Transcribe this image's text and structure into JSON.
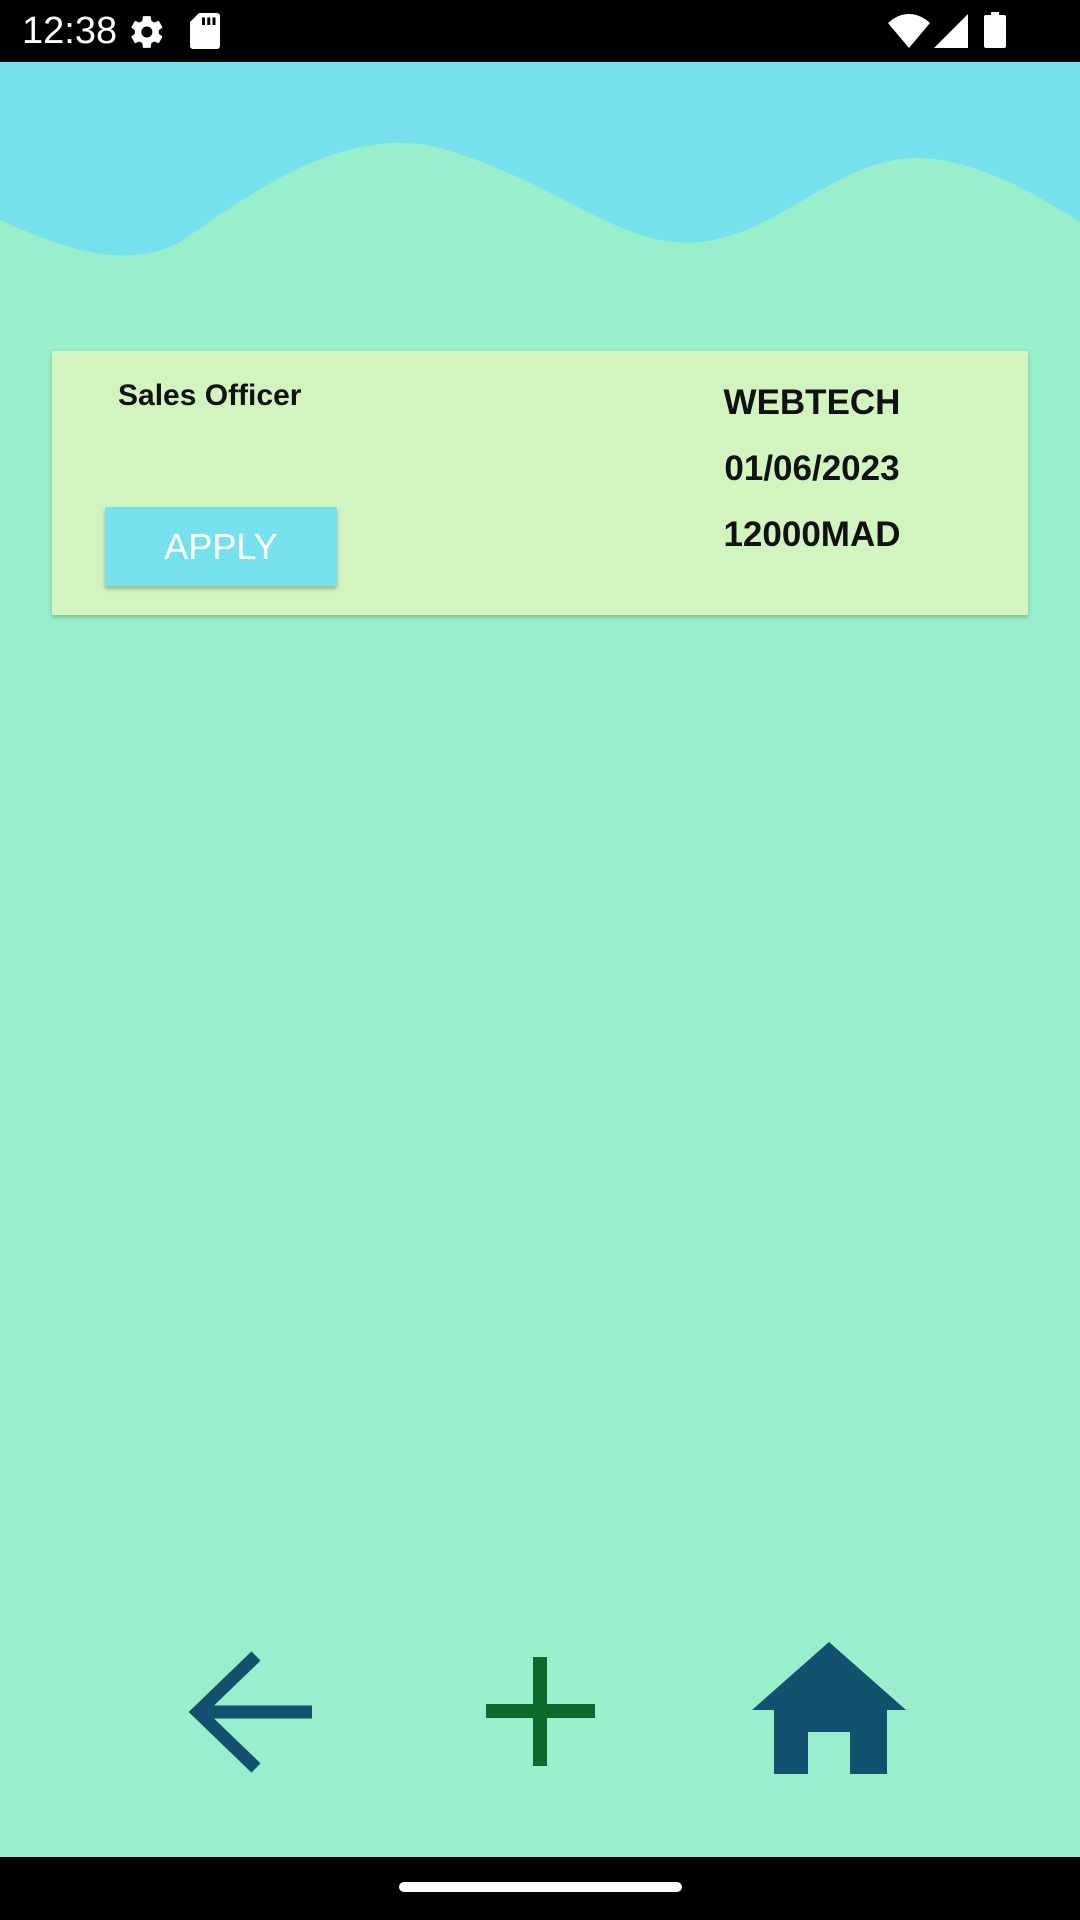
{
  "status_bar": {
    "time": "12:38",
    "left_icons": [
      "gear-icon",
      "sd-card-icon"
    ],
    "right_icons": [
      "wifi-icon",
      "cell-signal-icon",
      "battery-icon"
    ]
  },
  "colors": {
    "background": "#99eecb",
    "wave": "#76e1ec",
    "card": "#d2f5c0",
    "apply_button": "#76e1ec",
    "back_icon": "#12526e",
    "add_icon": "#0b6a2b",
    "home_icon": "#12526e"
  },
  "job_card": {
    "title": "Sales Officer",
    "apply_label": "APPLY",
    "company": "WEBTECH",
    "date": "01/06/2023",
    "salary": "12000MAD"
  },
  "bottom_nav": {
    "icons": [
      "arrow-left-icon",
      "plus-icon",
      "home-icon"
    ]
  }
}
